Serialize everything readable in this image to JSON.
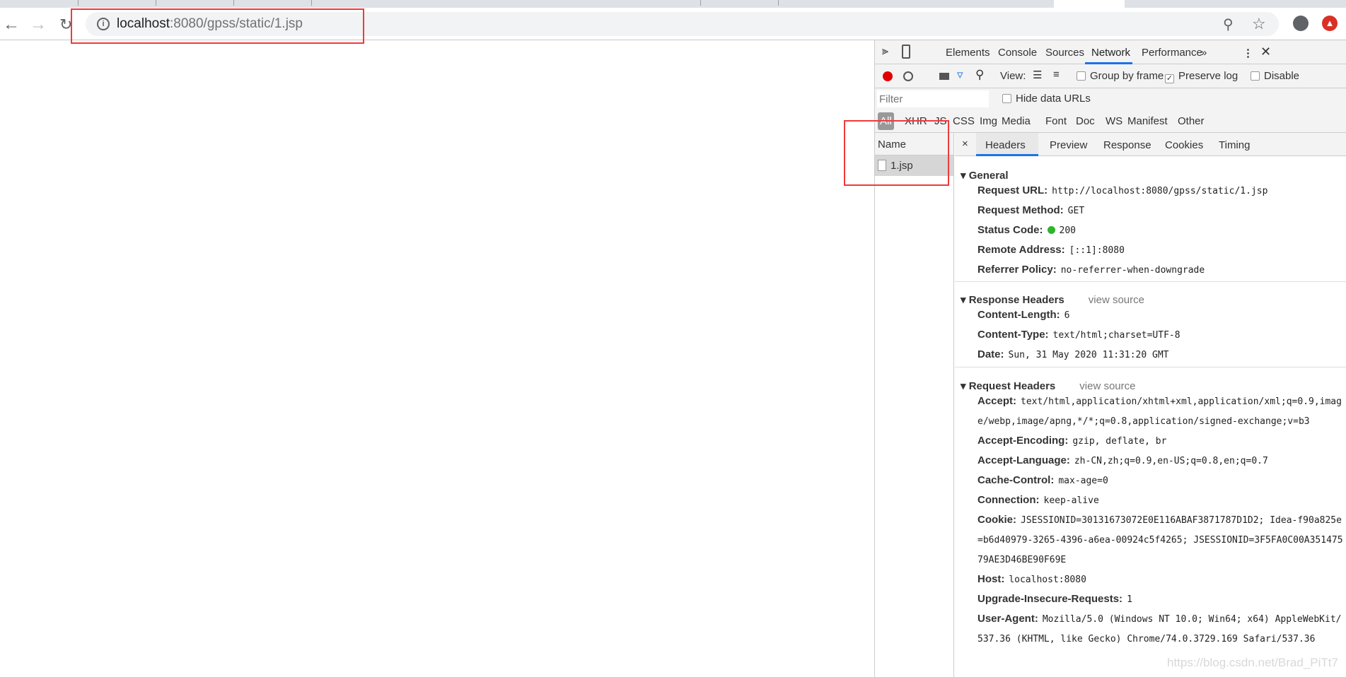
{
  "browser": {
    "url_host": "localhost",
    "url_rest": ":8080/gpss/static/1.jsp",
    "icons": [
      "back-icon",
      "forward-icon",
      "reload-icon",
      "info-icon",
      "zoom-out-icon",
      "star-icon",
      "account-icon",
      "update-icon"
    ]
  },
  "devtools": {
    "tabs": [
      "Elements",
      "Console",
      "Sources",
      "Network",
      "Performance"
    ],
    "active_tab": "Network",
    "more": "»",
    "view_label": "View:",
    "group_by_frame": "Group by frame",
    "preserve_log": "Preserve log",
    "disable_cache": "Disable",
    "filter_placeholder": "Filter",
    "hide_data_urls": "Hide data URLs",
    "types": [
      "All",
      "XHR",
      "JS",
      "CSS",
      "Img",
      "Media",
      "Font",
      "Doc",
      "WS",
      "Manifest",
      "Other"
    ],
    "name_header": "Name",
    "request_name": "1.jsp",
    "detail_close": "×",
    "detail_tabs": [
      "Headers",
      "Preview",
      "Response",
      "Cookies",
      "Timing"
    ],
    "general": {
      "title": "General",
      "rows": [
        {
          "k": "Request URL:",
          "v": "http://localhost:8080/gpss/static/1.jsp"
        },
        {
          "k": "Request Method:",
          "v": "GET"
        },
        {
          "k": "Status Code:",
          "v": "200"
        },
        {
          "k": "Remote Address:",
          "v": "[::1]:8080"
        },
        {
          "k": "Referrer Policy:",
          "v": "no-referrer-when-downgrade"
        }
      ]
    },
    "response": {
      "title": "Response Headers",
      "view_source": "view source",
      "rows": [
        {
          "k": "Content-Length:",
          "v": "6"
        },
        {
          "k": "Content-Type:",
          "v": "text/html;charset=UTF-8"
        },
        {
          "k": "Date:",
          "v": "Sun, 31 May 2020 11:31:20 GMT"
        }
      ]
    },
    "request": {
      "title": "Request Headers",
      "view_source": "view source",
      "rows": [
        {
          "k": "Accept:",
          "v": "text/html,application/xhtml+xml,application/xml;q=0.9,image/webp,image/apng,*/*;q=0.8,application/signed-exchange;v=b3"
        },
        {
          "k": "Accept-Encoding:",
          "v": "gzip, deflate, br"
        },
        {
          "k": "Accept-Language:",
          "v": "zh-CN,zh;q=0.9,en-US;q=0.8,en;q=0.7"
        },
        {
          "k": "Cache-Control:",
          "v": "max-age=0"
        },
        {
          "k": "Connection:",
          "v": "keep-alive"
        },
        {
          "k": "Cookie:",
          "v": "JSESSIONID=30131673072E0E116ABAF3871787D1D2; Idea-f90a825e=b6d40979-3265-4396-a6ea-00924c5f4265; JSESSIONID=3F5FA0C00A35147579AE3D46BE90F69E"
        },
        {
          "k": "Host:",
          "v": "localhost:8080"
        },
        {
          "k": "Upgrade-Insecure-Requests:",
          "v": "1"
        },
        {
          "k": "User-Agent:",
          "v": "Mozilla/5.0 (Windows NT 10.0; Win64; x64) AppleWebKit/537.36 (KHTML, like Gecko) Chrome/74.0.3729.169 Safari/537.36"
        }
      ]
    }
  },
  "colors": {
    "accent": "#1a73e8",
    "record": "#e00000",
    "status_ok": "#2db52d",
    "highlight": "#f03a3a"
  },
  "watermark": "https://blog.csdn.net/Brad_PiTt7"
}
